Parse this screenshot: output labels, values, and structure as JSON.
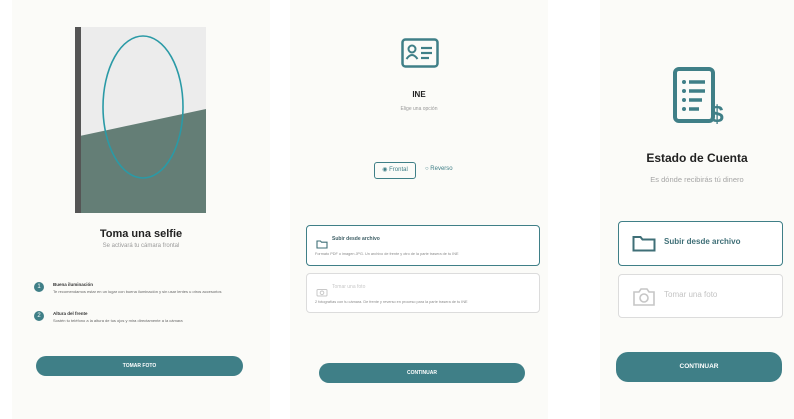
{
  "colors": {
    "accent": "#3f7f87",
    "background": "#fbfbf8"
  },
  "selfie": {
    "title": "Toma una selfie",
    "subtitle": "Se activará tu cámara frontal",
    "tips": [
      {
        "num": "1",
        "title": "Buena iluminación",
        "desc": "Te recomendamos estar en un lugar con buena iluminación y sin usar lentes u otros accesorios"
      },
      {
        "num": "2",
        "title": "Altura del frente",
        "desc": "Sostén tu teléfono a la altura de tus ojos y mira directamente a la cámara"
      }
    ],
    "button": "TOMAR FOTO"
  },
  "ine": {
    "title": "INE",
    "subtitle": "Elige una opción",
    "side_front": "Frontal",
    "side_back": "Reverso",
    "upload": {
      "title": "Subir desde archivo",
      "desc": "Formato PDF o imagen JPG. Un archivo de frente y otro de la parte trasera de tu INE"
    },
    "photo": {
      "title": "Tomar una foto",
      "desc": "2 fotografías con tu cámara. De frente y reverso en proceso para la parte trasera de tu INE"
    },
    "button": "CONTINUAR"
  },
  "statement": {
    "title": "Estado de Cuenta",
    "subtitle": "Es dónde recibirás tú dinero",
    "upload_label": "Subir desde archivo",
    "photo_label": "Tomar una foto",
    "button": "CONTINUAR"
  }
}
